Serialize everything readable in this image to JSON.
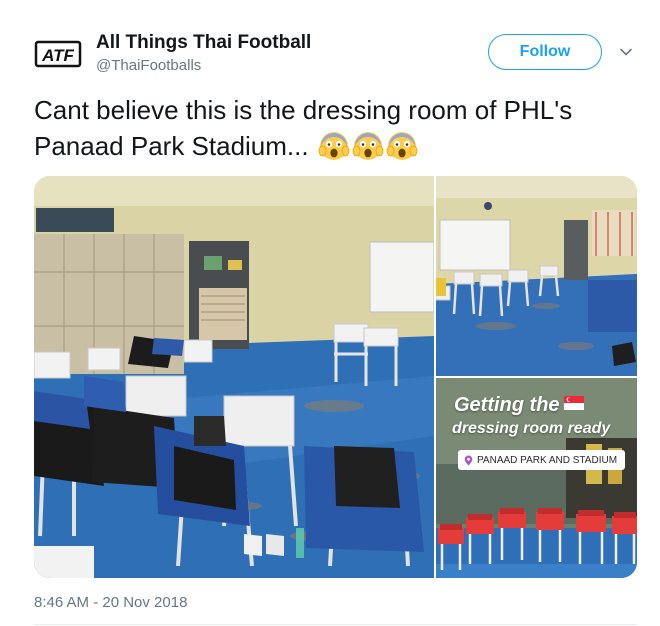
{
  "author": {
    "display_name": "All Things Thai Football",
    "handle": "@ThaiFootballs",
    "avatar_text": "ATF"
  },
  "actions": {
    "follow_label": "Follow"
  },
  "tweet": {
    "text": "Cant believe this is the dressing room of PHL's Panaad Park Stadium...",
    "emoji_names": [
      "face-screaming-in-fear",
      "face-screaming-in-fear",
      "face-screaming-in-fear"
    ],
    "timestamp": "8:46 AM - 20 Nov 2018"
  },
  "media": {
    "story_title": "Getting the",
    "story_subtitle": "dressing room ready",
    "location_tag": "PANAAD PARK AND STADIUM"
  },
  "colors": {
    "accent": "#1da1f2",
    "secondary_text": "#657786",
    "primary_text": "#14171a"
  }
}
